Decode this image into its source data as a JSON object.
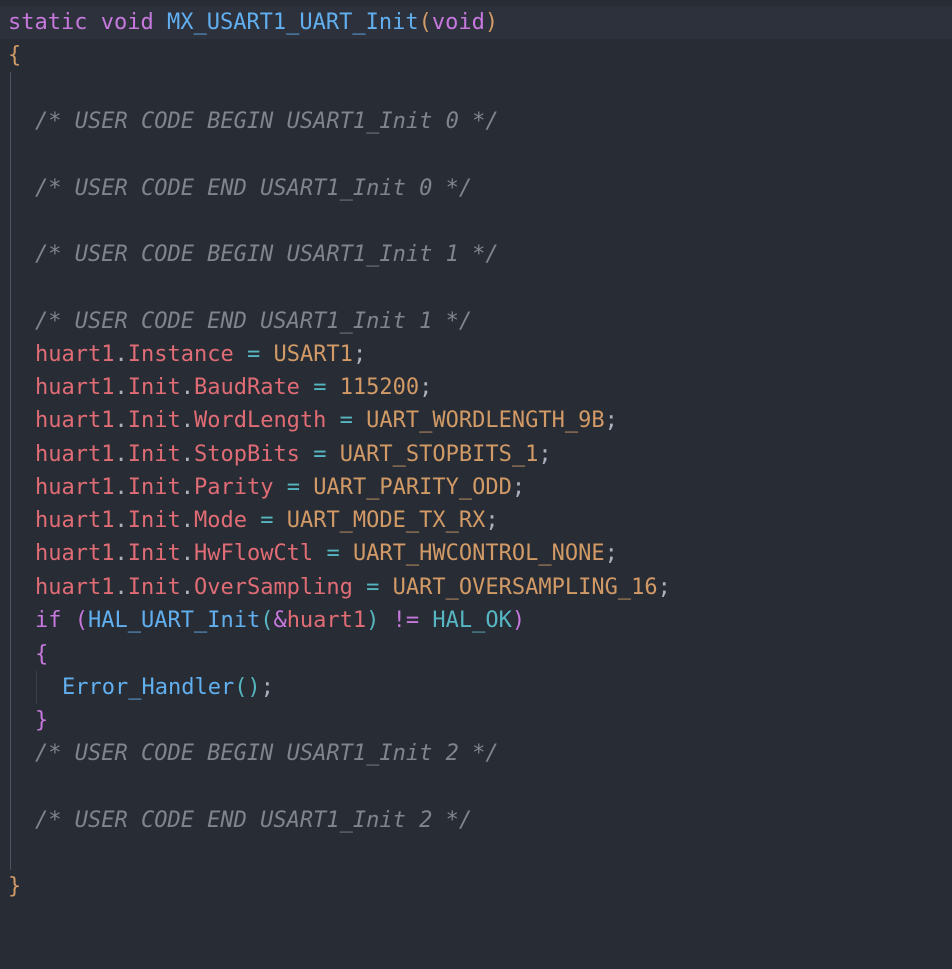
{
  "code": {
    "signature": {
      "kw_static": "static",
      "kw_void": "void",
      "func_name": "MX_USART1_UART_Init",
      "paren_open": "(",
      "param_void": "void",
      "paren_close": ")"
    },
    "open_brace": "{",
    "comment_begin_0": "/* USER CODE BEGIN USART1_Init 0 */",
    "comment_end_0": "/* USER CODE END USART1_Init 0 */",
    "comment_begin_1": "/* USER CODE BEGIN USART1_Init 1 */",
    "comment_end_1": "/* USER CODE END USART1_Init 1 */",
    "assignments": [
      {
        "obj": "huart1",
        "path": [
          "Instance"
        ],
        "value": "USART1"
      },
      {
        "obj": "huart1",
        "path": [
          "Init",
          "BaudRate"
        ],
        "value": "115200"
      },
      {
        "obj": "huart1",
        "path": [
          "Init",
          "WordLength"
        ],
        "value": "UART_WORDLENGTH_9B"
      },
      {
        "obj": "huart1",
        "path": [
          "Init",
          "StopBits"
        ],
        "value": "UART_STOPBITS_1"
      },
      {
        "obj": "huart1",
        "path": [
          "Init",
          "Parity"
        ],
        "value": "UART_PARITY_ODD"
      },
      {
        "obj": "huart1",
        "path": [
          "Init",
          "Mode"
        ],
        "value": "UART_MODE_TX_RX"
      },
      {
        "obj": "huart1",
        "path": [
          "Init",
          "HwFlowCtl"
        ],
        "value": "UART_HWCONTROL_NONE"
      },
      {
        "obj": "huart1",
        "path": [
          "Init",
          "OverSampling"
        ],
        "value": "UART_OVERSAMPLING_16"
      }
    ],
    "if_stmt": {
      "kw_if": "if",
      "paren_open": "(",
      "call_fn": "HAL_UART_Init",
      "call_paren_open": "(",
      "amp": "&",
      "call_arg": "huart1",
      "call_paren_close": ")",
      "op_neq": "!=",
      "const_ok": "HAL_OK",
      "paren_close": ")"
    },
    "inner_open_brace": "{",
    "error_call": {
      "fn": "Error_Handler",
      "args": "()",
      "semi": ";"
    },
    "inner_close_brace": "}",
    "comment_begin_2": "/* USER CODE BEGIN USART1_Init 2 */",
    "comment_end_2": "/* USER CODE END USART1_Init 2 */",
    "close_brace": "}"
  }
}
